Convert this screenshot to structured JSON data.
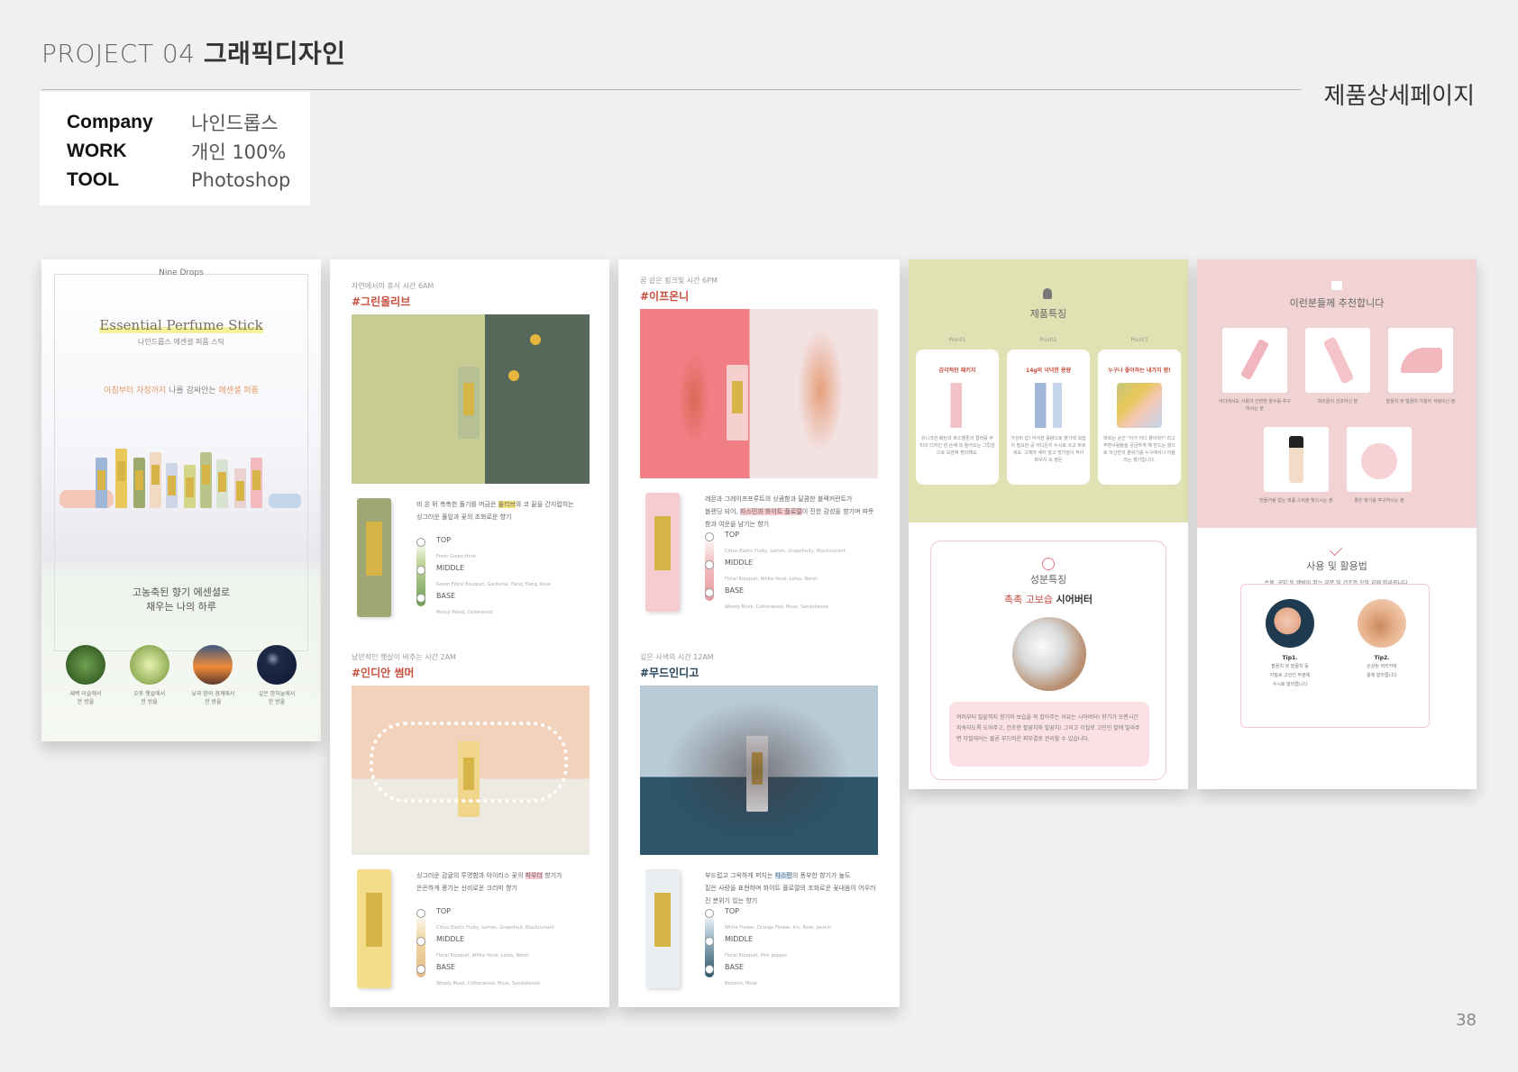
{
  "header": {
    "project_prefix": "PROJECT 04 ",
    "project_title": "그래픽디자인",
    "category": "제품상세페이지",
    "page_number": "38"
  },
  "info": [
    {
      "key": "Company",
      "value": "나인드롭스"
    },
    {
      "key": "WORK",
      "value": "개인 100%"
    },
    {
      "key": "TOOL",
      "value": "Photoshop"
    }
  ],
  "panel1": {
    "brand": "Nine Drops",
    "title": "Essential Perfume Stick",
    "subtitle": "나인드롭스 에센셜 퍼퓸 스틱",
    "tagline_a": "아침부터 자정까지",
    "tagline_b": " 나를 감싸안는 ",
    "tagline_c": "에센셜 퍼퓸",
    "quote_1": "고농축된 향기 에센셜로",
    "quote_2": "채우는 나의 하루",
    "moments": [
      {
        "l1": "새벽 이슬에서",
        "l2": "한 방울",
        "color": "#3c6b2c"
      },
      {
        "l1": "오후 햇살에서",
        "l2": "한 방울",
        "color": "#8fb14c"
      },
      {
        "l1": "낮과 밤의 경계에서",
        "l2": "한 방울",
        "color": "#e07a32"
      },
      {
        "l1": "깊은 밤하늘에서",
        "l2": "한 방울",
        "color": "#1f2a44"
      }
    ]
  },
  "scents": [
    {
      "time": "자연에서의 휴식 시간 6AM",
      "tag": "#그린올리브",
      "d1": "비 온 뒤 촉촉한 풀기를 머금은 ",
      "h1": "올리브",
      "d2": "와 코 끝을 간지럽히는",
      "d3": "싱그러운 풀잎과 꽃의 조화로운 향기",
      "hl": "y",
      "notes": [
        {
          "n": "TOP",
          "d": "Fresh Green Herb"
        },
        {
          "n": "MIDDLE",
          "d": "Green Floral Bouquet, Gardenia, Ylang Ylang, Rose"
        },
        {
          "n": "BASE",
          "d": "Mossy Wood, Cedarwood"
        }
      ]
    },
    {
      "time": "꿈 같은 핑크빛 시간 6PM",
      "tag": "#이프온니",
      "d1": "레몬과 그레이프프루트의 상큼함과 달콤한 블랙커런트가",
      "h1": "자스민과 화이트 플로럴",
      "d2": "블렌딩 되어, ",
      "d3": "이 진한 감성을 향기며 따뜻함과 여운을 남기는 향기",
      "hl": "p",
      "notes": [
        {
          "n": "TOP",
          "d": "Citrus Exotic Fruity, Lemon, Grapefruity, Blackcurrant"
        },
        {
          "n": "MIDDLE",
          "d": "Floral Bouquet, White floral, Lotus, Neroli"
        },
        {
          "n": "BASE",
          "d": "Woody Musk, Cottonwood, Musk, Sandalwood"
        }
      ]
    },
    {
      "time": "낭만적인 햇살이 비추는 시간 2AM",
      "tag": "#인디안 썸머",
      "d1": "싱그러운 감귤의 투명함과 아이리스 꽃의 ",
      "h1": "파우더",
      "d2": " 향기가",
      "d3": "은은하게 풍기는 신비로운 크리미 향기",
      "hl": "p",
      "notes": [
        {
          "n": "TOP",
          "d": "Citrus Exotic Fruity, Lemon, Grapefruit, Blackcurrant"
        },
        {
          "n": "MIDDLE",
          "d": "Floral Bouquet, White floral, Lotus, Neroli"
        },
        {
          "n": "BASE",
          "d": "Woody Musk, Cottonwood, Musk, Sandalwood"
        }
      ]
    },
    {
      "time": "깊은 사색의 시간 12AM",
      "tag": "#무드인디고",
      "d1": "부드럽고 그윽하게 퍼지는 ",
      "h1": "자스민",
      "d2": "의 풍부한 향기가 높도",
      "d3": "짙은 사랑을 표현하며 화이트 플로럴의 조화로운 꽃내음이 어우러진 분위기 있는 향기",
      "hl": "b",
      "notes": [
        {
          "n": "TOP",
          "d": "White Flower, Orange Flower, Iris, Rose, Jasmin"
        },
        {
          "n": "MIDDLE",
          "d": "Floral Bouquet, Pink pepper"
        },
        {
          "n": "BASE",
          "d": "Benzoin, Musk"
        }
      ]
    }
  ],
  "panel4": {
    "title": "제품특징",
    "points": [
      {
        "label": "Point1",
        "head": "감각적인 패키지",
        "text": "유니크한 패턴과 파스텔톤의 컬러를 부티의 디자인 한 손에 쏙 들어오는 그립감으로 보관에 편리해요."
      },
      {
        "label": "Point2",
        "head": "14g의 넉넉한 용량",
        "text": "가성비 갑! 넉넉한 용량으로 향기에 보습이 필요한 곳 어디든지 수시로 쓰고 바르세요. 고체라 새지 않고 망가짐이 적어 파우치 속 정돈"
      },
      {
        "label": "Point3",
        "head": "누구나 좋아하는 내가지 향!",
        "text": "바르는 순간 \"이거 어디 향이야?\" 라고 주변사람들을 궁금하게 해 만드는 향으로 자신만의 분위기를 누구에서나 어울리는 향기입니다."
      }
    ],
    "ing_title": "성분특징",
    "ing_sub_a": "촉촉 고보습 ",
    "ing_sub_b": "시어버터",
    "ing_text": "여러부터 발끝까지 향기와 보습을 꼭 잡아주는 이유는 시어버터! 향기가 오랜시간 지속되도록 도와주고, 건조한 팔꿈치와 발꿈치! 그리고 각질로 고민인 발에 발라주면 각질케어는 물론 부드러운 피부결로 관리할 수 있습니다."
  },
  "panel5": {
    "title": "이런분들께 추천합니다",
    "recs": [
      {
        "t": "어디에서도 사용이 간편한 향수를 추구하시는 분"
      },
      {
        "t": "머리끝이 건조하신 분"
      },
      {
        "t": "발꿈치 및 발꿈치 각질이 걱정이신 분"
      },
      {
        "t": "번들거림 없는 퍼퓸 스틱을 찾으시는 분"
      },
      {
        "t": "좋은 향기를 추구하시는 분"
      }
    ],
    "usage_title": "사용 및 활용법",
    "usage_sub": "손목, 귀밑 등 맥박이 뛰는 부분 및 건조한 모발 끝에 발라줍니다.",
    "tips": [
      {
        "h": "Tip1.",
        "t1": "팔꿈치 및 발꿈치 등",
        "t2": "각질로 고민인 부분에",
        "t3": "수시로 발라줍니다"
      },
      {
        "h": "Tip2.",
        "t1": "손상된 머리카락",
        "t2": "끝에 발라줍니다",
        "t3": ""
      }
    ]
  }
}
